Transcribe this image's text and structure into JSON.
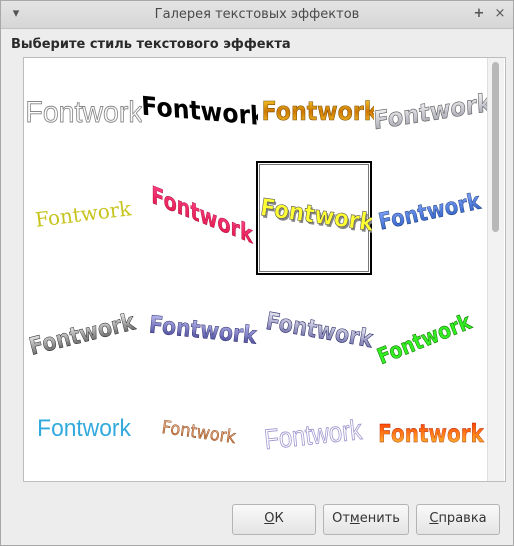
{
  "window": {
    "title": "Галерея текстовых эффектов"
  },
  "caption": "Выберите стиль текстового эффекта",
  "effects": [
    {
      "text": "Fontwork",
      "style": "outline-gray"
    },
    {
      "text": "Fontwork",
      "style": "black-wave"
    },
    {
      "text": "Fontwork",
      "style": "gold-gradient"
    },
    {
      "text": "Fontwork",
      "style": "silver-outline"
    },
    {
      "text": "Fontwork",
      "style": "yellow-serif"
    },
    {
      "text": "Fontwork",
      "style": "red-perspective"
    },
    {
      "text": "Fontwork",
      "style": "yellow-shadow",
      "selected": true
    },
    {
      "text": "Fontwork",
      "style": "blue-angle"
    },
    {
      "text": "Fontwork",
      "style": "gray-slant"
    },
    {
      "text": "Fontwork",
      "style": "navy-gradient"
    },
    {
      "text": "Fontwork",
      "style": "purple-arc"
    },
    {
      "text": "Fontwork",
      "style": "green-arch"
    },
    {
      "text": "Fontwork",
      "style": "cyan-plain"
    },
    {
      "text": "Fontwork",
      "style": "copper-arc"
    },
    {
      "text": "Fontwork",
      "style": "lavender-outline"
    },
    {
      "text": "Fontwork",
      "style": "red-orange"
    }
  ],
  "buttons": {
    "ok": {
      "mnemonic": "O",
      "rest": "К"
    },
    "cancel": {
      "pre": "От",
      "mnemonic": "м",
      "rest": "енить"
    },
    "help": {
      "mnemonic": "С",
      "rest": "правка"
    }
  },
  "colors": {
    "selected_border": "#000000",
    "gallery_bg": "#ffffff",
    "dialog_bg": "#ededed"
  }
}
